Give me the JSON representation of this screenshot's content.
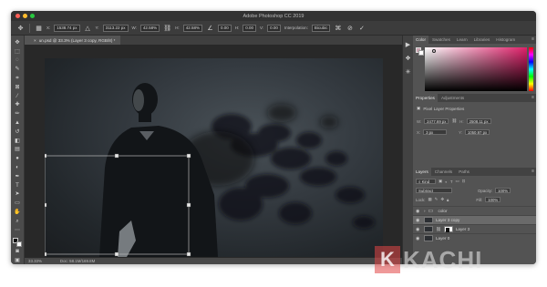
{
  "window": {
    "title": "Adobe Photoshop CC 2019"
  },
  "options_bar": {
    "x_label": "X:",
    "x_value": "1538.74 px",
    "y_label": "Y:",
    "y_value": "3113.22 px",
    "w_label": "W:",
    "w_value": "42.58%",
    "h_label": "H:",
    "h_value": "42.58%",
    "angle_value": "0.00",
    "h_skew_label": "H:",
    "h_skew_value": "0.00",
    "v_skew_label": "V:",
    "v_skew_value": "0.00",
    "interpolation_label": "Interpolation:",
    "interpolation_value": "Bicubic"
  },
  "document": {
    "tab_label": "un.psd @ 33.3% (Layer 3 copy, RGB/8) *",
    "zoom": "33.33%",
    "doc_info": "Doc: 58.1M/169.8M"
  },
  "color_panel": {
    "tabs": [
      "Color",
      "Swatches",
      "Learn",
      "Libraries",
      "Histogram"
    ],
    "foreground": "#c9a3b0",
    "background": "#ffffff",
    "hue_color": "#e0206a"
  },
  "properties_panel": {
    "tabs": [
      "Properties",
      "Adjustments"
    ],
    "section_title": "Pixel Layer Properties",
    "w_label": "W:",
    "w_value": "2477.69 px",
    "h_label": "H:",
    "h_value": "2508.11 px",
    "x_label": "X:",
    "x_value": "3 px",
    "y_label": "Y:",
    "y_value": "1050.97 px"
  },
  "layers_panel": {
    "tabs": [
      "Layers",
      "Channels",
      "Paths"
    ],
    "blend_mode": "Subtract",
    "opacity_label": "Opacity:",
    "opacity_value": "100%",
    "lock_label": "Lock:",
    "fill_label": "Fill:",
    "fill_value": "100%",
    "layers": [
      {
        "name": "color",
        "type": "folder"
      },
      {
        "name": "Layer 3 copy",
        "type": "pixel",
        "active": true
      },
      {
        "name": "Layer 3",
        "type": "masked"
      },
      {
        "name": "Layer 0",
        "type": "pixel"
      }
    ]
  },
  "watermark": {
    "badge": "K",
    "text": "KACHI"
  }
}
